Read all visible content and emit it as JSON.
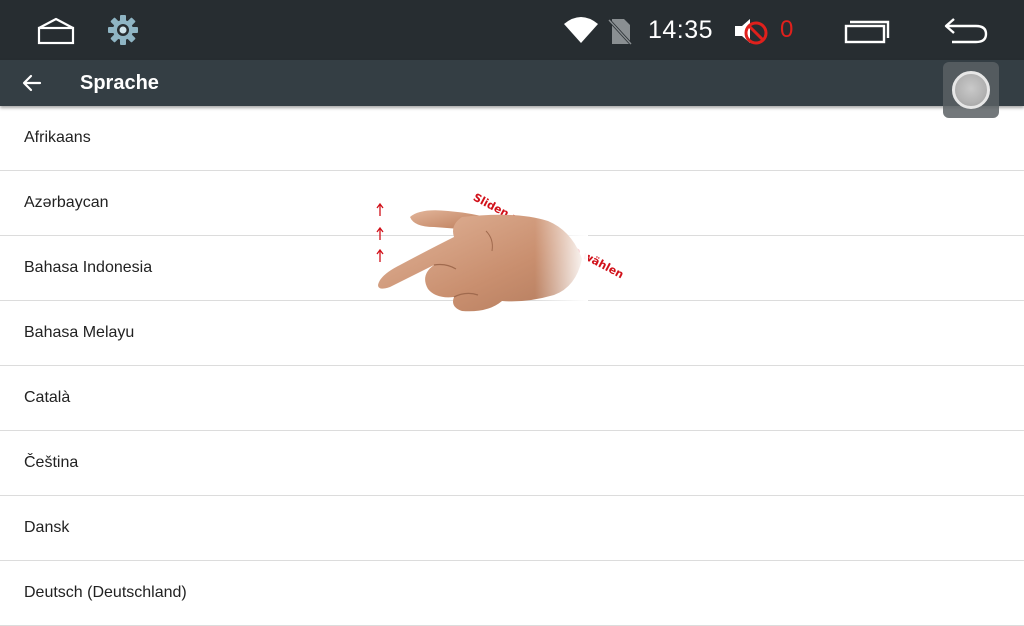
{
  "status_bar": {
    "time": "14:35",
    "notification_count": "0",
    "icons": [
      "home-icon",
      "gear-icon",
      "wifi-icon",
      "no-signal-icon",
      "volume-muted-icon",
      "recents-icon",
      "back-icon"
    ],
    "count_color": "#e0201c"
  },
  "action_bar": {
    "title": "Sprache",
    "background": "#343e44"
  },
  "languages": [
    "Afrikaans",
    "Azərbaycan",
    "Bahasa Indonesia",
    "Bahasa Melayu",
    "Català",
    "Čeština",
    "Dansk",
    "Deutsch (Deutschland)"
  ],
  "overlay": {
    "hint": "Sliden und Sprache wählen",
    "hint_color": "#d1111a"
  }
}
